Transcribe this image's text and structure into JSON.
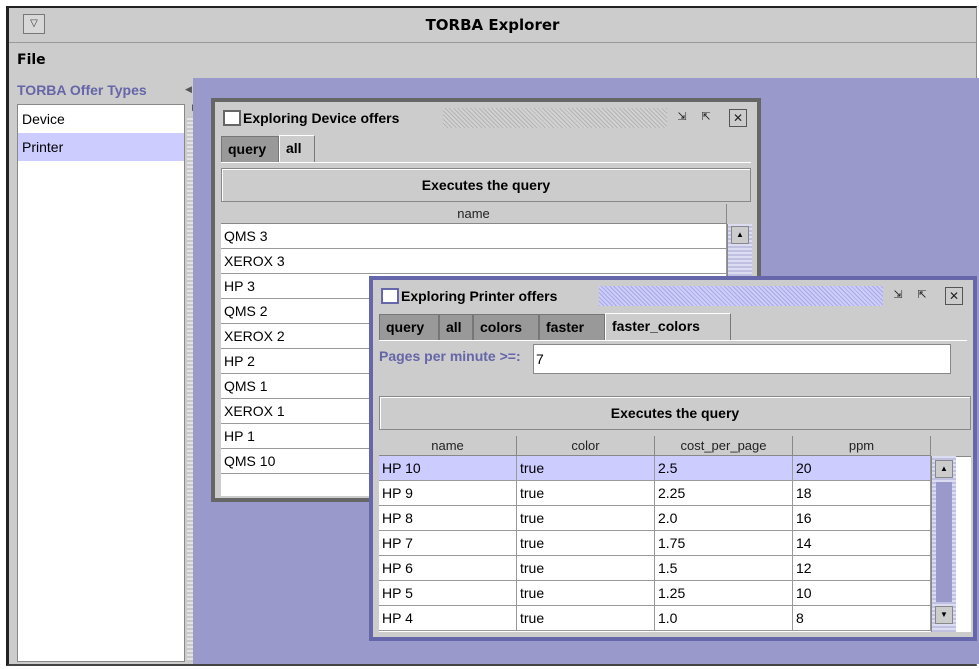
{
  "app": {
    "title": "TORBA Explorer",
    "window_menu_glyph": "▽"
  },
  "menubar": {
    "file_label": "File"
  },
  "sidebar": {
    "header": "TORBA Offer Types",
    "items": [
      {
        "label": "Device",
        "selected": false
      },
      {
        "label": "Printer",
        "selected": true
      }
    ]
  },
  "device_window": {
    "title": "Exploring Device offers",
    "tabs": [
      {
        "label": "query",
        "active": false
      },
      {
        "label": "all",
        "active": true
      }
    ],
    "execute_label": "Executes the query",
    "table": {
      "columns": [
        "name"
      ],
      "rows": [
        [
          "QMS 3"
        ],
        [
          "XEROX 3"
        ],
        [
          "HP 3"
        ],
        [
          "QMS 2"
        ],
        [
          "XEROX 2"
        ],
        [
          "HP 2"
        ],
        [
          "QMS 1"
        ],
        [
          "XEROX 1"
        ],
        [
          "HP 1"
        ],
        [
          "QMS 10"
        ]
      ]
    }
  },
  "printer_window": {
    "title": "Exploring Printer offers",
    "tabs": [
      {
        "label": "query",
        "active": false
      },
      {
        "label": "all",
        "active": false
      },
      {
        "label": "colors",
        "active": false
      },
      {
        "label": "faster",
        "active": false
      },
      {
        "label": "faster_colors",
        "active": true
      }
    ],
    "filter": {
      "label": "Pages per minute >=:",
      "value": "7"
    },
    "execute_label": "Executes the query",
    "table": {
      "columns": [
        "name",
        "color",
        "cost_per_page",
        "ppm"
      ],
      "rows": [
        [
          "HP 10",
          "true",
          "2.5",
          "20"
        ],
        [
          "HP 9",
          "true",
          "2.25",
          "18"
        ],
        [
          "HP 8",
          "true",
          "2.0",
          "16"
        ],
        [
          "HP 7",
          "true",
          "1.75",
          "14"
        ],
        [
          "HP 6",
          "true",
          "1.5",
          "12"
        ],
        [
          "HP 5",
          "true",
          "1.25",
          "10"
        ],
        [
          "HP 4",
          "true",
          "1.0",
          "8"
        ]
      ],
      "selected_row": 0
    }
  },
  "icons": {
    "minimize": "minimize-icon",
    "maximize": "maximize-icon",
    "close": "close-icon",
    "scroll_up": "scroll-up-arrow-icon",
    "scroll_down": "scroll-down-arrow-icon"
  },
  "colors": {
    "desktop": "#9999cc",
    "selection": "#ccccff",
    "accent_text": "#6565a8",
    "panel": "#cccccc"
  }
}
